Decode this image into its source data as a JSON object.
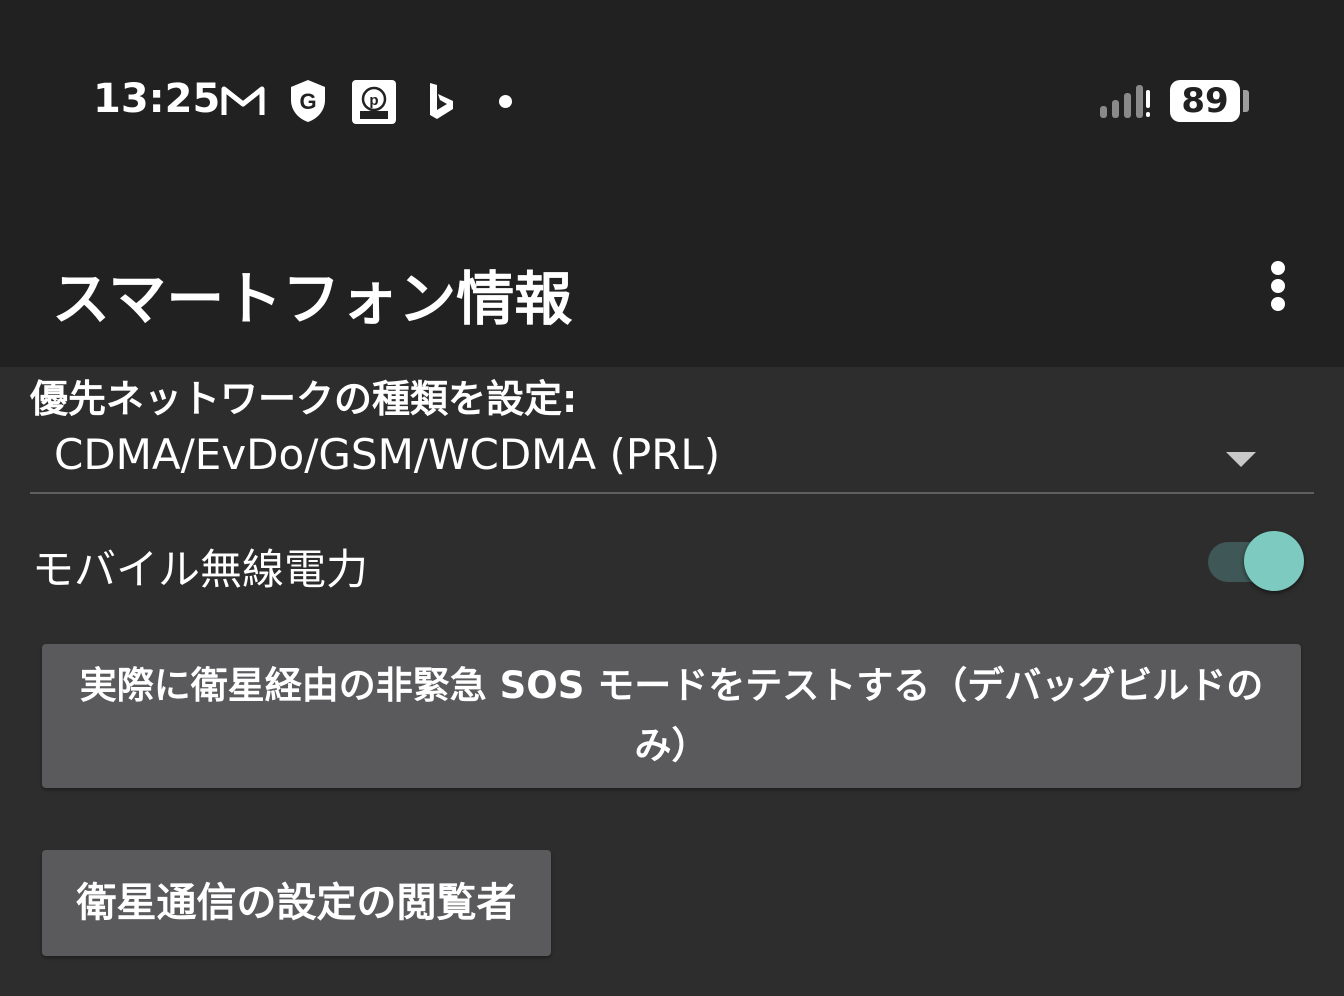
{
  "status_bar": {
    "time": "13:25",
    "notification_icons": [
      "gmail-icon",
      "shield-g-icon",
      "p-club-icon",
      "bing-icon",
      "more-notifications-dot"
    ],
    "signal_icon": "cell-signal-icon",
    "battery_level": "89"
  },
  "toolbar": {
    "title": "スマートフォン情報",
    "overflow_icon": "more-vert-icon"
  },
  "network": {
    "label": "優先ネットワークの種類を設定:",
    "selected": "CDMA/EvDo/GSM/WCDMA (PRL)"
  },
  "mobile_radio": {
    "label": "モバイル無線電力",
    "enabled": true
  },
  "buttons": {
    "sos_test": "実際に衛星経由の非緊急 SOS モードをテストする（デバッグビルドのみ）",
    "satellite_viewer": "衛星通信の設定の閲覧者"
  },
  "colors": {
    "toolbar_bg": "#212121",
    "content_bg": "#2d2d2d",
    "button_bg": "#5a5a5c",
    "toggle_thumb": "#7ccac0",
    "toggle_track": "#3f5756"
  }
}
